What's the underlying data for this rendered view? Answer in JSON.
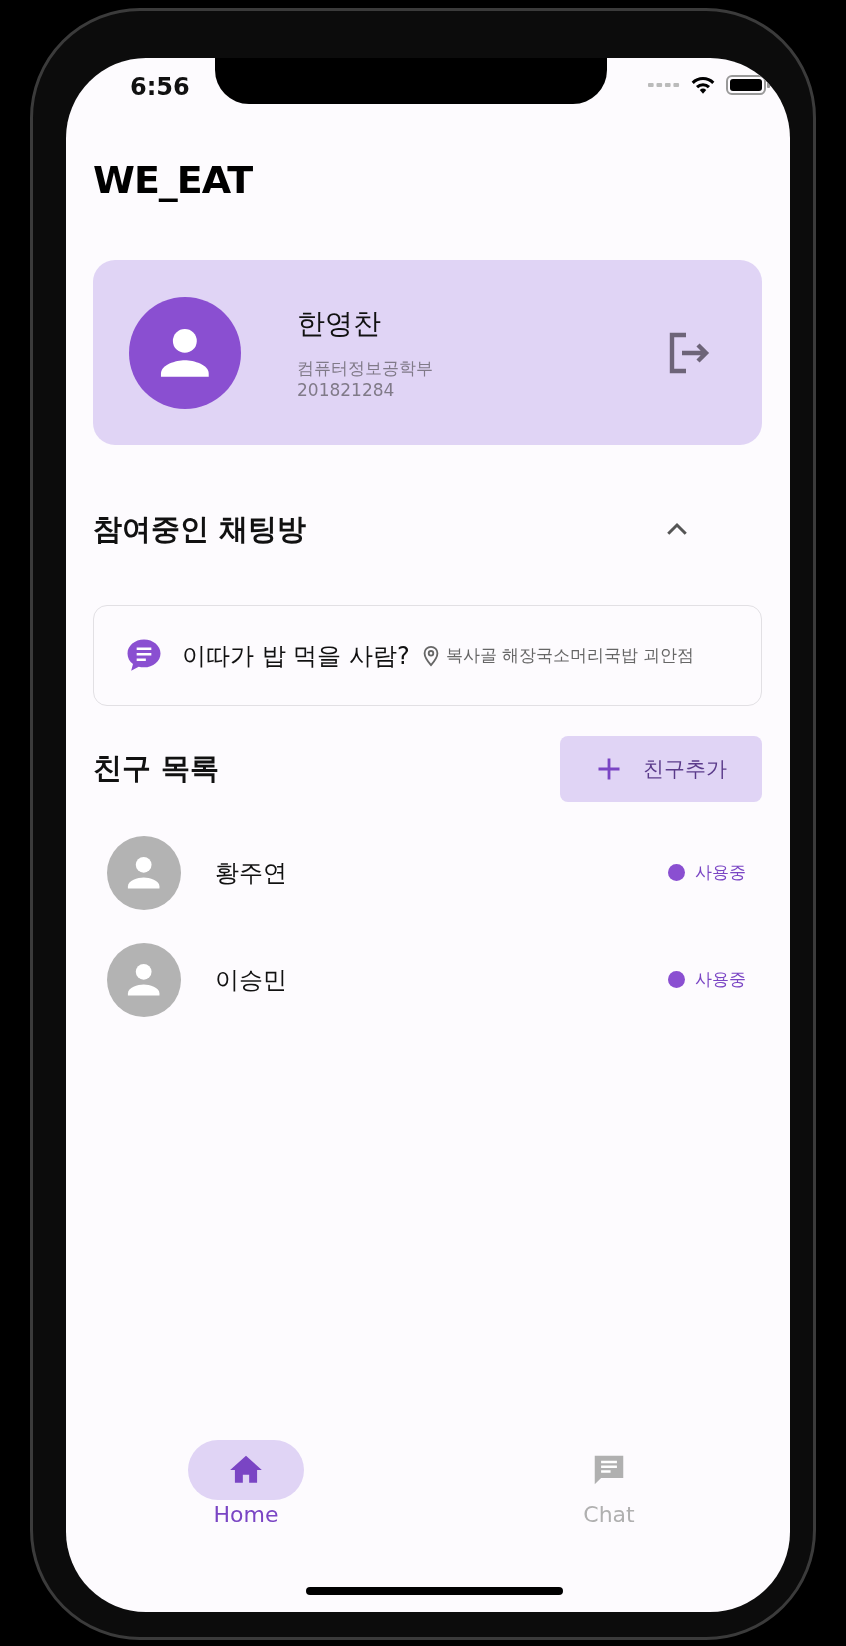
{
  "status_bar": {
    "time": "6:56"
  },
  "app_title": "WE_EAT",
  "profile": {
    "name": "한영찬",
    "department": "컴퓨터정보공학부",
    "student_id": "201821284"
  },
  "chat_section": {
    "title": "참여중인 채팅방",
    "expanded": true,
    "rooms": [
      {
        "title": "이따가 밥 먹을 사람?",
        "location": "복사골 해장국소머리국밥 괴안점"
      }
    ]
  },
  "friends": {
    "title": "친구 목록",
    "add_button": "친구추가",
    "items": [
      {
        "name": "황주연",
        "status": "사용중",
        "online": true
      },
      {
        "name": "이승민",
        "status": "사용중",
        "online": true
      }
    ]
  },
  "nav": [
    {
      "label": "Home",
      "kind": "home",
      "selected": true
    },
    {
      "label": "Chat",
      "kind": "chat",
      "selected": false
    }
  ]
}
